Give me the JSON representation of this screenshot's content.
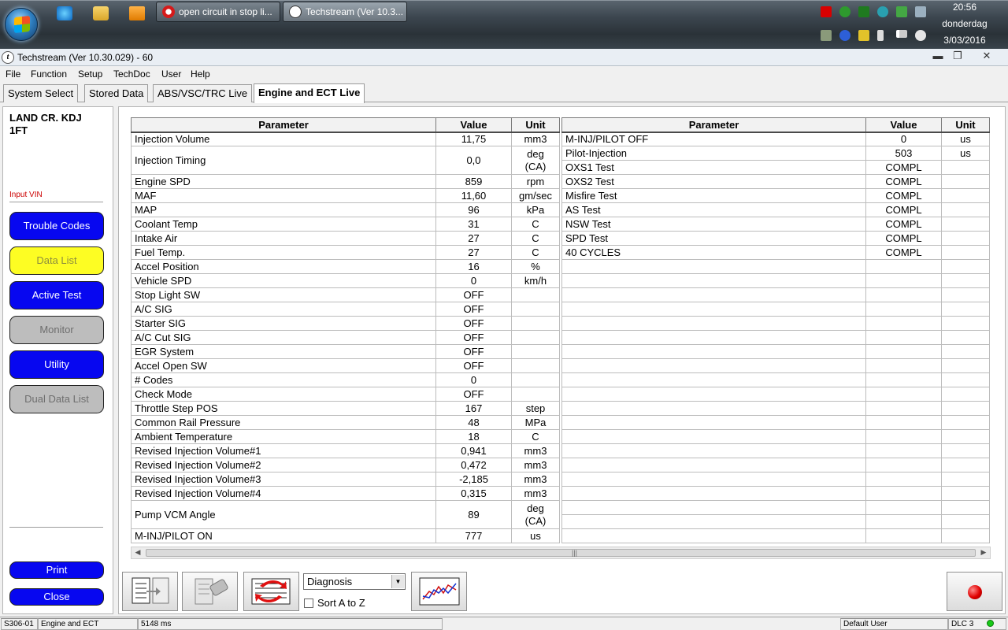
{
  "taskbar": {
    "tasks": [
      {
        "label": "open circuit in stop li..."
      },
      {
        "label": "Techstream (Ver 10.3..."
      }
    ],
    "clock": {
      "time": "20:56",
      "day": "donderdag",
      "date": "3/03/2016"
    }
  },
  "window": {
    "title": "Techstream (Ver 10.30.029) - 60",
    "minimize": "▬",
    "restore": "❐",
    "close": "✕"
  },
  "menu": [
    "File",
    "Function",
    "Setup",
    "TechDoc",
    "User",
    "Help"
  ],
  "tabs": [
    "System Select",
    "Stored Data",
    "ABS/VSC/TRC Live",
    "Engine and ECT Live"
  ],
  "vehicle": {
    "line1": "LAND CR. KDJ",
    "line2": "1FT"
  },
  "input_vin": "Input VIN",
  "side_buttons": {
    "trouble_codes": "Trouble Codes",
    "data_list": "Data List",
    "active_test": "Active Test",
    "monitor": "Monitor",
    "utility": "Utility",
    "dual_data_list": "Dual Data List",
    "print": "Print",
    "close": "Close"
  },
  "headers": {
    "parameter": "Parameter",
    "value": "Value",
    "unit": "Unit"
  },
  "left_rows": [
    {
      "p": "Injection Volume",
      "v": "11,75",
      "u": "mm3"
    },
    {
      "p": "Injection Timing",
      "v": "0,0",
      "u": "deg\n(CA)"
    },
    {
      "p": "Engine SPD",
      "v": "859",
      "u": "rpm"
    },
    {
      "p": "MAF",
      "v": "11,60",
      "u": "gm/sec"
    },
    {
      "p": "MAP",
      "v": "96",
      "u": "kPa"
    },
    {
      "p": "Coolant Temp",
      "v": "31",
      "u": "C"
    },
    {
      "p": "Intake Air",
      "v": "27",
      "u": "C"
    },
    {
      "p": "Fuel Temp.",
      "v": "27",
      "u": "C"
    },
    {
      "p": "Accel Position",
      "v": "16",
      "u": "%"
    },
    {
      "p": "Vehicle SPD",
      "v": "0",
      "u": "km/h"
    },
    {
      "p": "Stop Light SW",
      "v": "OFF",
      "u": ""
    },
    {
      "p": "A/C SIG",
      "v": "OFF",
      "u": ""
    },
    {
      "p": "Starter SIG",
      "v": "OFF",
      "u": ""
    },
    {
      "p": "A/C Cut SIG",
      "v": "OFF",
      "u": ""
    },
    {
      "p": "EGR System",
      "v": "OFF",
      "u": ""
    },
    {
      "p": "Accel Open SW",
      "v": "OFF",
      "u": ""
    },
    {
      "p": "# Codes",
      "v": "0",
      "u": ""
    },
    {
      "p": "Check Mode",
      "v": "OFF",
      "u": ""
    },
    {
      "p": "Throttle Step POS",
      "v": "167",
      "u": "step"
    },
    {
      "p": "Common Rail Pressure",
      "v": "48",
      "u": "MPa"
    },
    {
      "p": "Ambient Temperature",
      "v": "18",
      "u": "C"
    },
    {
      "p": "Revised Injection Volume#1",
      "v": "0,941",
      "u": "mm3"
    },
    {
      "p": "Revised Injection Volume#2",
      "v": "0,472",
      "u": "mm3"
    },
    {
      "p": "Revised Injection Volume#3",
      "v": "-2,185",
      "u": "mm3"
    },
    {
      "p": "Revised Injection Volume#4",
      "v": "0,315",
      "u": "mm3"
    },
    {
      "p": "Pump VCM Angle",
      "v": "89",
      "u": "deg\n(CA)"
    },
    {
      "p": "M-INJ/PILOT ON",
      "v": "777",
      "u": "us"
    }
  ],
  "right_rows": [
    {
      "p": "M-INJ/PILOT OFF",
      "v": "0",
      "u": "us"
    },
    {
      "p": "Pilot-Injection",
      "v": "503",
      "u": "us"
    },
    {
      "p": "OXS1 Test",
      "v": "COMPL",
      "u": ""
    },
    {
      "p": "OXS2 Test",
      "v": "COMPL",
      "u": ""
    },
    {
      "p": "Misfire Test",
      "v": "COMPL",
      "u": ""
    },
    {
      "p": "AS Test",
      "v": "COMPL",
      "u": ""
    },
    {
      "p": "NSW Test",
      "v": "COMPL",
      "u": ""
    },
    {
      "p": "SPD Test",
      "v": "COMPL",
      "u": ""
    },
    {
      "p": "40 CYCLES",
      "v": "COMPL",
      "u": ""
    }
  ],
  "right_empty_rows": 20,
  "scroll_grip": "|||",
  "toolbar": {
    "diagnosis": "Diagnosis",
    "sort_label": "Sort A to Z"
  },
  "status": {
    "code": "S306-01",
    "system": "Engine and ECT",
    "time": "5148 ms",
    "user": "Default User",
    "dlc": "DLC 3"
  },
  "colors": {
    "button_blue": "#0707f0",
    "button_yellow": "#fdfd23",
    "button_gray": "#bdbdbd",
    "led_green": "#18c918"
  }
}
